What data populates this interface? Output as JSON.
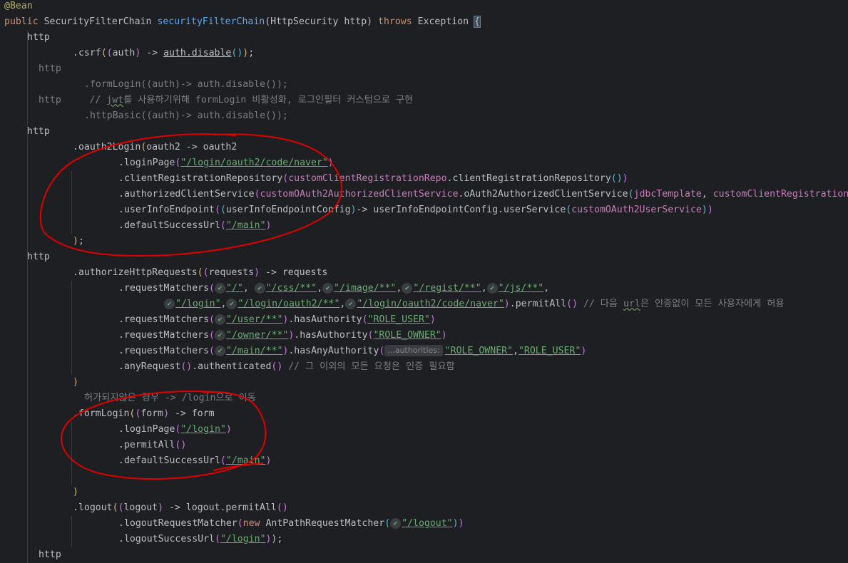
{
  "editor": {
    "theme_colors": {
      "background": "#1e1f22",
      "default_text": "#bcbec4",
      "keyword": "#cf8e6d",
      "function": "#56a8f5",
      "string": "#6aab73",
      "comment": "#7a7e85",
      "annotation": "#b3ae60",
      "field": "#c77dbb",
      "red_marker": "#e00000"
    },
    "lines": [
      {
        "indent": 0,
        "tokens": [
          {
            "text": "@Bean",
            "c": "t-ann"
          }
        ]
      },
      {
        "indent": 0,
        "tokens": [
          {
            "text": "public ",
            "c": "t-kw"
          },
          {
            "text": "SecurityFilterChain "
          },
          {
            "text": "securityFilterChain",
            "c": "t-fn"
          },
          {
            "text": "(HttpSecurity http) "
          },
          {
            "text": "throws ",
            "c": "t-kw"
          },
          {
            "text": "Exception "
          },
          {
            "text": "{",
            "c": "caret-brace"
          }
        ]
      },
      {
        "indent": 1,
        "tokens": [
          {
            "text": "http"
          }
        ]
      },
      {
        "indent": 3,
        "tokens": [
          {
            "text": ".csrf"
          },
          {
            "text": "(",
            "c": "t-par1"
          },
          {
            "text": "(",
            "c": "t-par2"
          },
          {
            "text": "auth"
          },
          {
            "text": ")",
            "c": "t-par2"
          },
          {
            "text": " -> "
          },
          {
            "text": "auth.disable",
            "c": "t-u"
          },
          {
            "text": "()",
            "c": "t-par3"
          },
          {
            "text": ")",
            "c": "t-par1"
          },
          {
            "text": ";"
          }
        ]
      },
      {
        "indent": 1.5,
        "tokens": [
          {
            "text": "http",
            "c": "t-cm"
          }
        ]
      },
      {
        "indent": 3.5,
        "tokens": [
          {
            "text": ".formLogin((auth)-> auth.disable());",
            "c": "t-cm"
          }
        ]
      },
      {
        "indent": 1.5,
        "tokens": [
          {
            "text": "http     // ",
            "c": "t-cm"
          },
          {
            "text": "jwt",
            "c": "t-cm-u"
          },
          {
            "text": "를 사용하기위해 formLogin 비활성화, 로그인필터 커스텀으로 구현",
            "c": "t-cm"
          }
        ]
      },
      {
        "indent": 3.5,
        "tokens": [
          {
            "text": ".httpBasic((auth)-> auth.disable());",
            "c": "t-cm"
          }
        ]
      },
      {
        "indent": 1,
        "tokens": [
          {
            "text": "http"
          }
        ]
      },
      {
        "indent": 3,
        "tokens": [
          {
            "text": ".oauth2Login"
          },
          {
            "text": "(",
            "c": "t-par1"
          },
          {
            "text": "oauth2 -> oauth2"
          }
        ]
      },
      {
        "indent": 5,
        "tokens": [
          {
            "text": ".loginPage"
          },
          {
            "text": "(",
            "c": "t-par2"
          },
          {
            "text": "\"/login/oauth2/code/naver\"",
            "c": "t-str-u"
          },
          {
            "text": ")",
            "c": "t-par2"
          }
        ]
      },
      {
        "indent": 5,
        "tokens": [
          {
            "text": ".clientRegistrationRepository"
          },
          {
            "text": "(",
            "c": "t-par2"
          },
          {
            "text": "customClientRegistrationRepo",
            "c": "t-field"
          },
          {
            "text": ".clientRegistrationRepository"
          },
          {
            "text": "()",
            "c": "t-par3"
          },
          {
            "text": ")",
            "c": "t-par2"
          }
        ]
      },
      {
        "indent": 5,
        "tokens": [
          {
            "text": ".authorizedClientService"
          },
          {
            "text": "(",
            "c": "t-par2"
          },
          {
            "text": "customOAuth2AuthorizedClientService",
            "c": "t-field"
          },
          {
            "text": ".oAuth2AuthorizedClientService"
          },
          {
            "text": "(",
            "c": "t-par3"
          },
          {
            "text": "jdbcTemplate",
            "c": "t-field"
          },
          {
            "text": ", "
          },
          {
            "text": "customClientRegistration",
            "c": "t-field"
          }
        ]
      },
      {
        "indent": 5,
        "tokens": [
          {
            "text": ".userInfoEndpoint"
          },
          {
            "text": "(",
            "c": "t-par2"
          },
          {
            "text": "(",
            "c": "t-par3"
          },
          {
            "text": "userInfoEndpointConfig"
          },
          {
            "text": ")",
            "c": "t-par3"
          },
          {
            "text": "-> userInfoEndpointConfig.userService"
          },
          {
            "text": "(",
            "c": "t-par3"
          },
          {
            "text": "customOAuth2UserService",
            "c": "t-field"
          },
          {
            "text": ")",
            "c": "t-par3"
          },
          {
            "text": ")",
            "c": "t-par2"
          }
        ]
      },
      {
        "indent": 5,
        "tokens": [
          {
            "text": ".defaultSuccessUrl"
          },
          {
            "text": "(",
            "c": "t-par2"
          },
          {
            "text": "\"/main\"",
            "c": "t-str-u"
          },
          {
            "text": ")",
            "c": "t-par2"
          }
        ]
      },
      {
        "indent": 3,
        "tokens": [
          {
            "text": ")",
            "c": "t-par1"
          },
          {
            "text": ";"
          }
        ]
      },
      {
        "indent": 1,
        "tokens": [
          {
            "text": "http"
          }
        ]
      },
      {
        "indent": 3,
        "tokens": [
          {
            "text": ".authorizeHttpRequests"
          },
          {
            "text": "(",
            "c": "t-par1"
          },
          {
            "text": "(",
            "c": "t-par2"
          },
          {
            "text": "requests"
          },
          {
            "text": ")",
            "c": "t-par2"
          },
          {
            "text": " -> requests"
          }
        ]
      },
      {
        "indent": 5,
        "tokens": [
          {
            "text": ".requestMatchers"
          },
          {
            "text": "(",
            "c": "t-par2"
          },
          {
            "icon": true
          },
          {
            "text": "\"/\"",
            "c": "t-str-u"
          },
          {
            "text": ", "
          },
          {
            "icon": true
          },
          {
            "text": "\"/css/**\"",
            "c": "t-str-u"
          },
          {
            "text": ","
          },
          {
            "icon": true
          },
          {
            "text": "\"/image/**\"",
            "c": "t-str-u"
          },
          {
            "text": ","
          },
          {
            "icon": true
          },
          {
            "text": "\"/regist/**\"",
            "c": "t-str-u"
          },
          {
            "text": ","
          },
          {
            "icon": true
          },
          {
            "text": "\"/js/**\"",
            "c": "t-str-u"
          },
          {
            "text": ","
          }
        ]
      },
      {
        "indent": 7,
        "tokens": [
          {
            "icon": true
          },
          {
            "text": "\"/login\"",
            "c": "t-str-u"
          },
          {
            "text": ","
          },
          {
            "icon": true
          },
          {
            "text": "\"/login/oauth2/**\"",
            "c": "t-str-u"
          },
          {
            "text": ","
          },
          {
            "icon": true
          },
          {
            "text": "\"/login/oauth2/code/naver\"",
            "c": "t-str-u"
          },
          {
            "text": ")",
            "c": "t-par2"
          },
          {
            "text": ".permitAll"
          },
          {
            "text": "()",
            "c": "t-par2"
          },
          {
            "text": " // 다음 ",
            "c": "t-cm"
          },
          {
            "text": "url",
            "c": "t-cm-u"
          },
          {
            "text": "은 인증없이 모든 사용자에게 허용",
            "c": "t-cm"
          }
        ]
      },
      {
        "indent": 5,
        "tokens": [
          {
            "text": ".requestMatchers"
          },
          {
            "text": "(",
            "c": "t-par2"
          },
          {
            "icon": true
          },
          {
            "text": "\"/user/**\"",
            "c": "t-str-u"
          },
          {
            "text": ")",
            "c": "t-par2"
          },
          {
            "text": ".hasAuthority"
          },
          {
            "text": "(",
            "c": "t-par2"
          },
          {
            "text": "\"ROLE_USER\"",
            "c": "t-str-u"
          },
          {
            "text": ")",
            "c": "t-par2"
          }
        ]
      },
      {
        "indent": 5,
        "tokens": [
          {
            "text": ".requestMatchers"
          },
          {
            "text": "(",
            "c": "t-par2"
          },
          {
            "icon": true
          },
          {
            "text": "\"/owner/**\"",
            "c": "t-str-u"
          },
          {
            "text": ")",
            "c": "t-par2"
          },
          {
            "text": ".hasAuthority"
          },
          {
            "text": "(",
            "c": "t-par2"
          },
          {
            "text": "\"ROLE_OWNER\"",
            "c": "t-str-u"
          },
          {
            "text": ")",
            "c": "t-par2"
          }
        ]
      },
      {
        "indent": 5,
        "tokens": [
          {
            "text": ".requestMatchers"
          },
          {
            "text": "(",
            "c": "t-par2"
          },
          {
            "icon": true
          },
          {
            "text": "\"/main/**\"",
            "c": "t-str-u"
          },
          {
            "text": ")",
            "c": "t-par2"
          },
          {
            "text": ".hasAnyAuthority"
          },
          {
            "text": "(",
            "c": "t-par2"
          },
          {
            "hint": "...authorities:"
          },
          {
            "text": "\"ROLE_OWNER\"",
            "c": "t-str-u"
          },
          {
            "text": ","
          },
          {
            "text": "\"ROLE_USER\"",
            "c": "t-str-u"
          },
          {
            "text": ")",
            "c": "t-par2"
          }
        ]
      },
      {
        "indent": 5,
        "tokens": [
          {
            "text": ".anyRequest"
          },
          {
            "text": "()",
            "c": "t-par2"
          },
          {
            "text": ".authenticated"
          },
          {
            "text": "()",
            "c": "t-par2"
          },
          {
            "text": " // 그 이외의 모든 요청은 인증 필요함",
            "c": "t-cm"
          }
        ]
      },
      {
        "indent": 3,
        "tokens": [
          {
            "text": ")",
            "c": "t-par1"
          }
        ]
      },
      {
        "indent": 3.5,
        "tokens": [
          {
            "text": "허가되지않은 경우 -> /login으로 이동",
            "c": "t-cm"
          }
        ]
      },
      {
        "indent": 3,
        "tokens": [
          {
            "text": ".formLogin"
          },
          {
            "text": "(",
            "c": "t-par1"
          },
          {
            "text": "(",
            "c": "t-par2"
          },
          {
            "text": "form"
          },
          {
            "text": ")",
            "c": "t-par2"
          },
          {
            "text": " -> form"
          }
        ]
      },
      {
        "indent": 5,
        "tokens": [
          {
            "text": ".loginPage"
          },
          {
            "text": "(",
            "c": "t-par2"
          },
          {
            "text": "\"/login\"",
            "c": "t-str-u"
          },
          {
            "text": ")",
            "c": "t-par2"
          }
        ]
      },
      {
        "indent": 5,
        "tokens": [
          {
            "text": ".permitAll"
          },
          {
            "text": "()",
            "c": "t-par2"
          }
        ]
      },
      {
        "indent": 5,
        "tokens": [
          {
            "text": ".defaultSuccessUrl"
          },
          {
            "text": "(",
            "c": "t-par2"
          },
          {
            "text": "\"/main\"",
            "c": "t-str-u"
          },
          {
            "text": ")",
            "c": "t-par2"
          }
        ]
      },
      {
        "indent": 0,
        "tokens": []
      },
      {
        "indent": 3,
        "tokens": [
          {
            "text": ")",
            "c": "t-par1"
          }
        ]
      },
      {
        "indent": 3,
        "tokens": [
          {
            "text": ".logout"
          },
          {
            "text": "(",
            "c": "t-par1"
          },
          {
            "text": "(",
            "c": "t-par2"
          },
          {
            "text": "logout"
          },
          {
            "text": ")",
            "c": "t-par2"
          },
          {
            "text": " -> logout.permitAll"
          },
          {
            "text": "()",
            "c": "t-par2"
          }
        ]
      },
      {
        "indent": 5,
        "tokens": [
          {
            "text": ".logoutRequestMatcher"
          },
          {
            "text": "(",
            "c": "t-par2"
          },
          {
            "text": "new ",
            "c": "t-kw"
          },
          {
            "text": "AntPathRequestMatcher"
          },
          {
            "text": "(",
            "c": "t-par3"
          },
          {
            "icon": true
          },
          {
            "text": "\"/logout\"",
            "c": "t-str-u"
          },
          {
            "text": ")",
            "c": "t-par3"
          },
          {
            "text": ")",
            "c": "t-par2"
          }
        ]
      },
      {
        "indent": 5,
        "tokens": [
          {
            "text": ".logoutSuccessUrl"
          },
          {
            "text": "(",
            "c": "t-par2"
          },
          {
            "text": "\"/login\"",
            "c": "t-str-u"
          },
          {
            "text": ")",
            "c": "t-par2"
          },
          {
            "text": ");"
          }
        ]
      },
      {
        "indent": 1.5,
        "tokens": [
          {
            "text": "http"
          }
        ]
      }
    ]
  }
}
